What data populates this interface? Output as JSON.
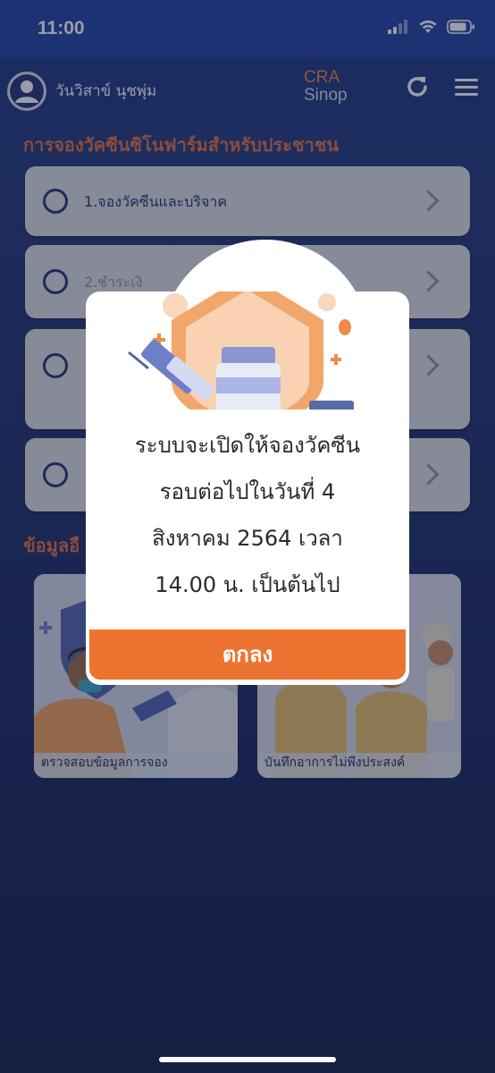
{
  "status_bar": {
    "time": "11:00"
  },
  "header": {
    "user_name": "วันวิสาข์ นุชพุ่ม",
    "logo_top": "CRA",
    "logo_bottom": "Sinop"
  },
  "booking": {
    "title": "การจองวัคซีนซิโนฟาร์มสำหรับประชาชน",
    "steps": [
      {
        "label": "1.จองวัคซีนและบริจาค"
      },
      {
        "label": "2.ชำระเงิ"
      },
      {
        "label": ""
      },
      {
        "label": ""
      }
    ]
  },
  "info": {
    "title": "ข้อมูลอื",
    "cards": [
      {
        "label": "ตรวจสอบข้อมูลการจอง"
      },
      {
        "label": "บันทึกอาการไม่พึงประสงค์"
      }
    ]
  },
  "modal": {
    "lines": [
      "ระบบจะเปิดให้จองวัคซีน",
      "รอบต่อไปในวันที่ 4",
      "สิงหาคม 2564 เวลา",
      "14.00 น. เป็นต้นไป"
    ],
    "ok_label": "ตกลง"
  },
  "colors": {
    "accent": "#ec7430",
    "brand": "#1c3173",
    "header": "#18347f"
  }
}
